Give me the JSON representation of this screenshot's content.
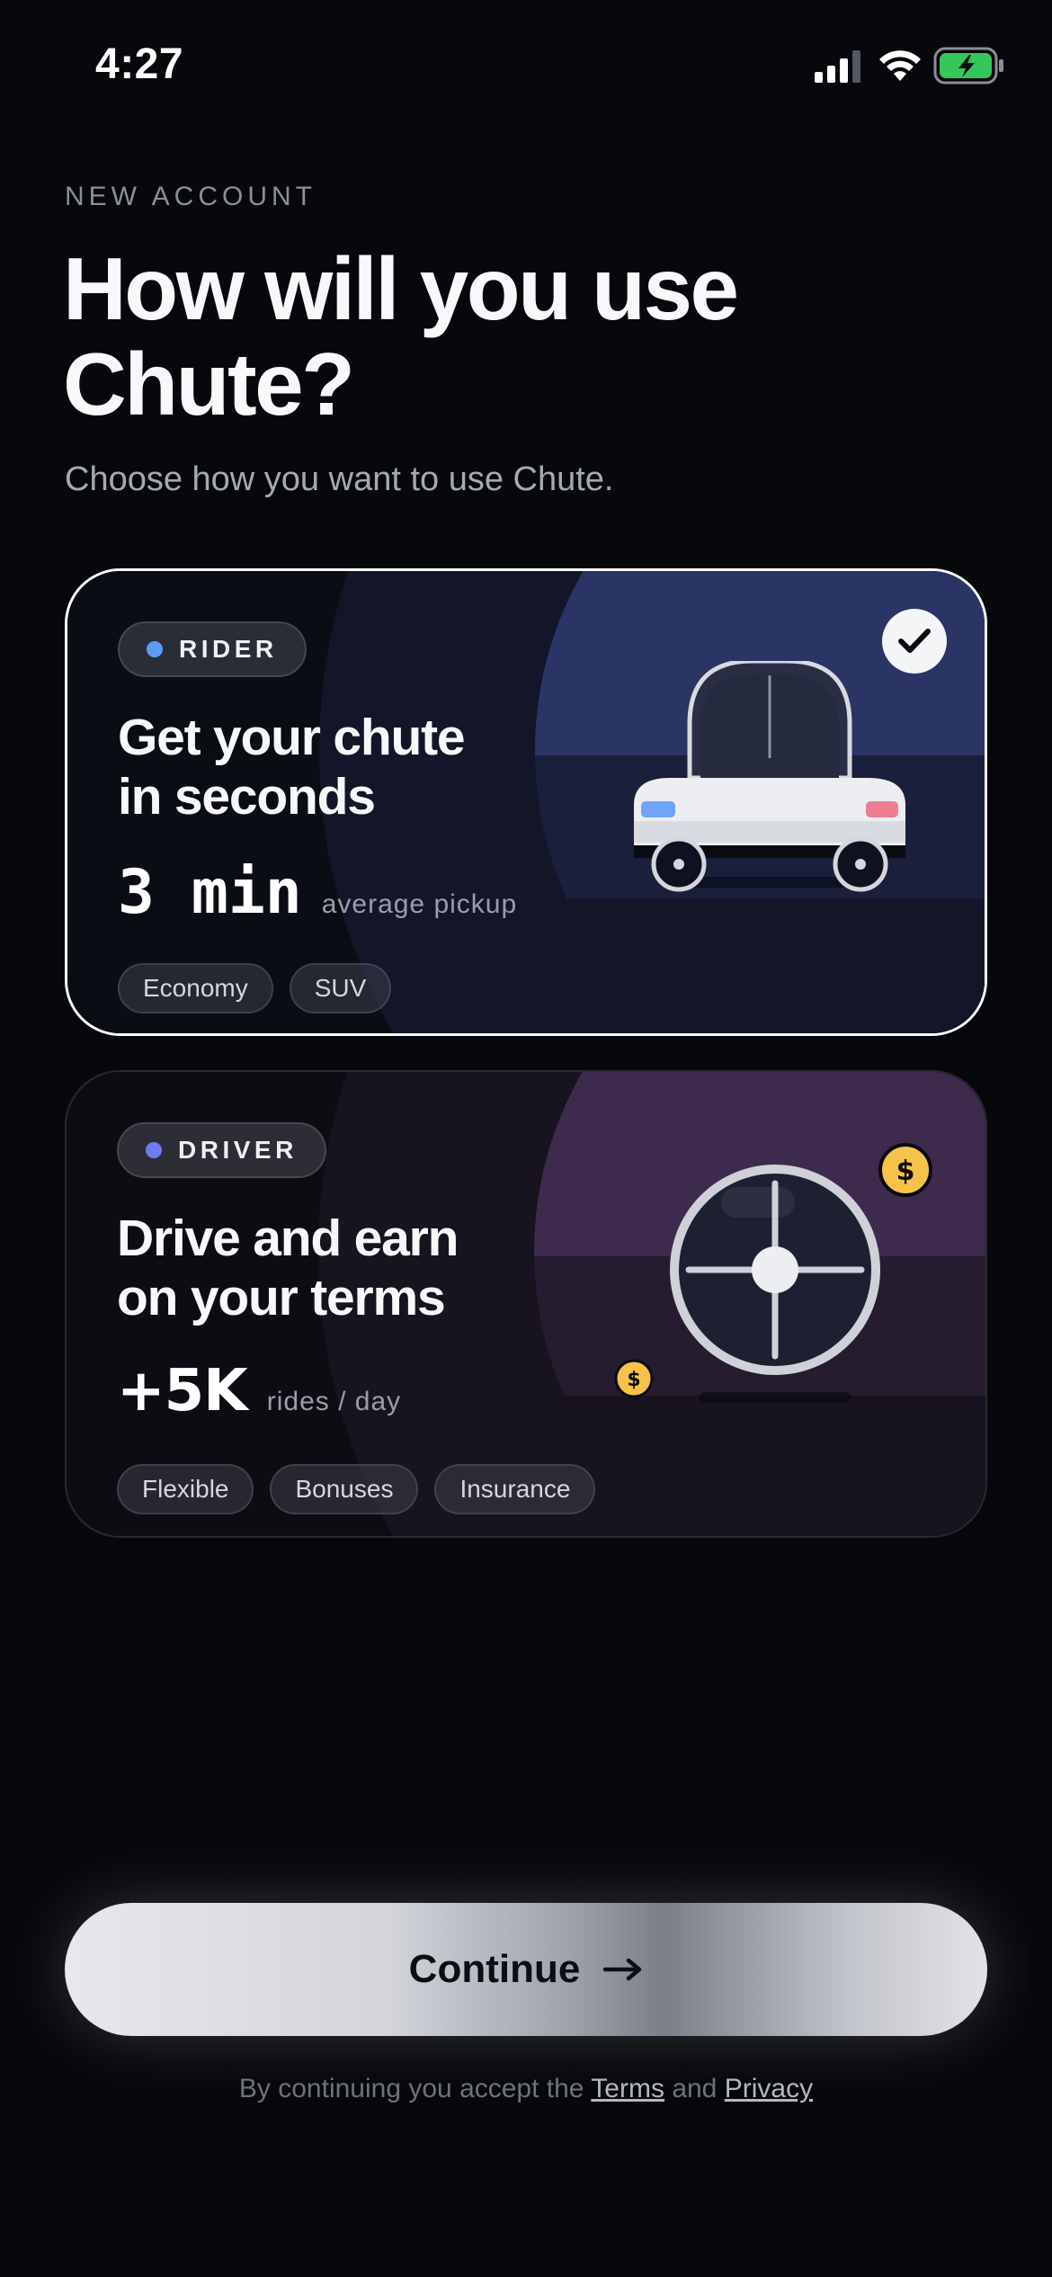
{
  "status_bar": {
    "time": "4:27"
  },
  "header": {
    "eyebrow": "NEW ACCOUNT",
    "title": "How will you use Chute?",
    "subtitle": "Choose how you want to use Chute."
  },
  "cards": [
    {
      "role": "RIDER",
      "headline_line1": "Get your chute",
      "headline_line2": "in seconds",
      "stat_value": "3 min",
      "stat_caption": "average pickup",
      "chips": [
        "Economy",
        "SUV"
      ],
      "selected": true,
      "accent": "#5b9cf6"
    },
    {
      "role": "DRIVER",
      "headline_line1": "Drive and earn",
      "headline_line2": "on your terms",
      "stat_value": "+5K",
      "stat_caption": "rides / day",
      "chips": [
        "Flexible",
        "Bonuses",
        "Insurance"
      ],
      "selected": false,
      "accent": "#6f7cf0"
    }
  ],
  "continue_button": {
    "label": "Continue"
  },
  "legal": {
    "prefix": "By continuing you accept the",
    "terms": "Terms",
    "and": "and",
    "privacy": "Privacy"
  },
  "colors": {
    "background": "#07080c",
    "rider_art_sky": "#2a3465",
    "driver_art_sky": "#3d2a4c",
    "coin": "#f5c34a"
  }
}
